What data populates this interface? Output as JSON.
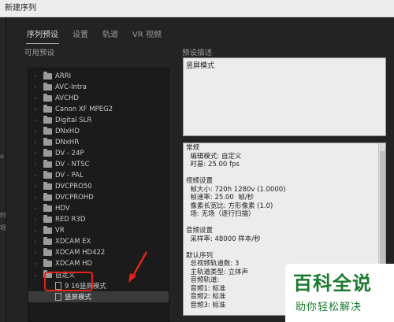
{
  "window": {
    "title": "新建序列"
  },
  "left_strip_texts": [
    "o",
    "时",
    "项"
  ],
  "tabs": [
    {
      "label": "序列预设",
      "active": true
    },
    {
      "label": "设置",
      "active": false
    },
    {
      "label": "轨道",
      "active": false
    },
    {
      "label": "VR 视频",
      "active": false
    }
  ],
  "available_presets": {
    "title": "可用预设",
    "items": [
      {
        "label": "ARRI",
        "type": "folder",
        "expanded": false
      },
      {
        "label": "AVC-Intra",
        "type": "folder",
        "expanded": false
      },
      {
        "label": "AVCHD",
        "type": "folder",
        "expanded": false
      },
      {
        "label": "Canon XF MPEG2",
        "type": "folder",
        "expanded": false
      },
      {
        "label": "Digital SLR",
        "type": "folder",
        "expanded": false
      },
      {
        "label": "DNxHD",
        "type": "folder",
        "expanded": false
      },
      {
        "label": "DNxHR",
        "type": "folder",
        "expanded": false
      },
      {
        "label": "DV - 24P",
        "type": "folder",
        "expanded": false
      },
      {
        "label": "DV - NTSC",
        "type": "folder",
        "expanded": false
      },
      {
        "label": "DV - PAL",
        "type": "folder",
        "expanded": false
      },
      {
        "label": "DVCPRO50",
        "type": "folder",
        "expanded": false
      },
      {
        "label": "DVCPROHD",
        "type": "folder",
        "expanded": false
      },
      {
        "label": "HDV",
        "type": "folder",
        "expanded": false
      },
      {
        "label": "RED R3D",
        "type": "folder",
        "expanded": false
      },
      {
        "label": "VR",
        "type": "folder",
        "expanded": false
      },
      {
        "label": "XDCAM EX",
        "type": "folder",
        "expanded": false
      },
      {
        "label": "XDCAM HD422",
        "type": "folder",
        "expanded": false
      },
      {
        "label": "XDCAM HD",
        "type": "folder",
        "expanded": false
      },
      {
        "label": "自定义",
        "type": "folder",
        "expanded": true
      },
      {
        "label": "9 16竖屏模式",
        "type": "file",
        "expanded": false
      },
      {
        "label": "竖屏模式",
        "type": "file",
        "expanded": false,
        "selected": true
      }
    ]
  },
  "preset_description": {
    "title": "预设描述",
    "text": "竖屏模式"
  },
  "preset_info": {
    "lines": [
      "常规",
      "  编辑模式: 自定义",
      "  时基: 25.00 fps",
      "",
      "视频设置",
      "  帧大小: 720h 1280v (1.0000)",
      "  帧速率: 25.00  帧/秒",
      "  像素长宽比: 方形像素 (1.0)",
      "  场: 无场（逐行扫描）",
      "",
      "音频设置",
      "  采样率: 48000 样本/秒",
      "",
      "默认序列",
      "  总视频轨道数: 3",
      "  主轨道类型: 立体声",
      "  音频轨道:",
      "  音频1: 标准",
      "  音频2: 标准",
      "  音频3: 标准"
    ]
  },
  "watermark": {
    "title": "百科全说",
    "subtitle": "助你轻松解决"
  },
  "colors": {
    "highlight_red": "#e0241b",
    "watermark_green": "#1a7a2e"
  }
}
